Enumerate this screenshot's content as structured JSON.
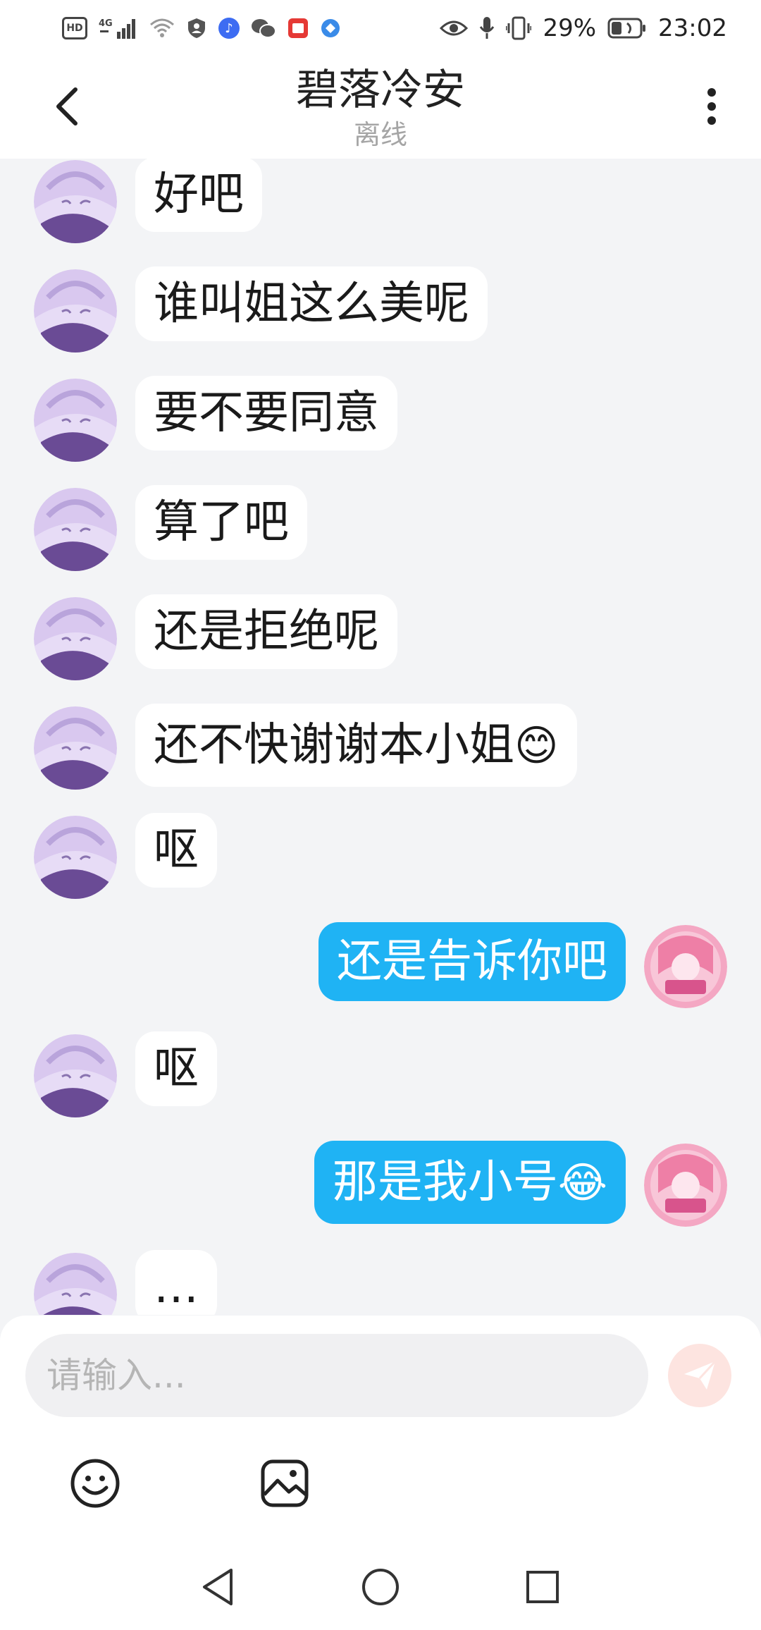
{
  "status_bar": {
    "network": "4G",
    "battery_percent": "29%",
    "time": "23:02"
  },
  "header": {
    "contact_name": "碧落冷安",
    "contact_status": "离线"
  },
  "messages": [
    {
      "side": "left",
      "text": "好吧"
    },
    {
      "side": "left",
      "text": "谁叫姐这么美呢"
    },
    {
      "side": "left",
      "text": "要不要同意"
    },
    {
      "side": "left",
      "text": "算了吧"
    },
    {
      "side": "left",
      "text": "还是拒绝呢"
    },
    {
      "side": "left",
      "text": "还不快谢谢本小姐",
      "emoji": "😊"
    },
    {
      "side": "left",
      "text": "呕"
    },
    {
      "side": "right",
      "text": "还是告诉你吧"
    },
    {
      "side": "left",
      "text": "呕"
    },
    {
      "side": "right",
      "text": "那是我小号",
      "emoji": "😂"
    },
    {
      "side": "left",
      "text": "…"
    }
  ],
  "input": {
    "placeholder": "请输入..."
  },
  "colors": {
    "outgoing_bubble": "#1fb3f4",
    "incoming_bubble": "#ffffff",
    "chat_background": "#f3f4f6",
    "send_button_bg": "#fde4e0"
  },
  "icons": {
    "back": "chevron-left-icon",
    "more": "vertical-dots-icon",
    "send": "paper-plane-icon",
    "emoji": "smiley-icon",
    "image": "image-icon",
    "nav_back": "triangle-back-icon",
    "nav_home": "circle-home-icon",
    "nav_recent": "square-recent-icon"
  }
}
